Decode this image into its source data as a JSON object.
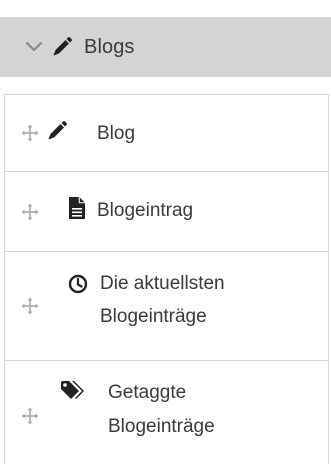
{
  "header": {
    "title": "Blogs",
    "icons": {
      "toggle": "chevron-down-icon",
      "section": "pencil-icon"
    }
  },
  "items": [
    {
      "label": "Blog",
      "icon": "pencil-icon",
      "handle": "drag-handle-icon"
    },
    {
      "label": "Blogeintrag",
      "icon": "file-icon",
      "handle": "drag-handle-icon"
    },
    {
      "label_line1": "Die aktuellsten",
      "label_line2": "Blogeinträge",
      "icon": "clock-icon",
      "handle": "drag-handle-icon"
    },
    {
      "label_line1": "Getaggte",
      "label_line2": "Blogeinträge",
      "icon": "tags-icon",
      "handle": "drag-handle-icon"
    }
  ],
  "colors": {
    "header_bg": "#d4d4d4",
    "border": "#d6d6d6",
    "text": "#3a3a3a",
    "icon_dark": "#222222",
    "handle": "#aaaaaa"
  }
}
